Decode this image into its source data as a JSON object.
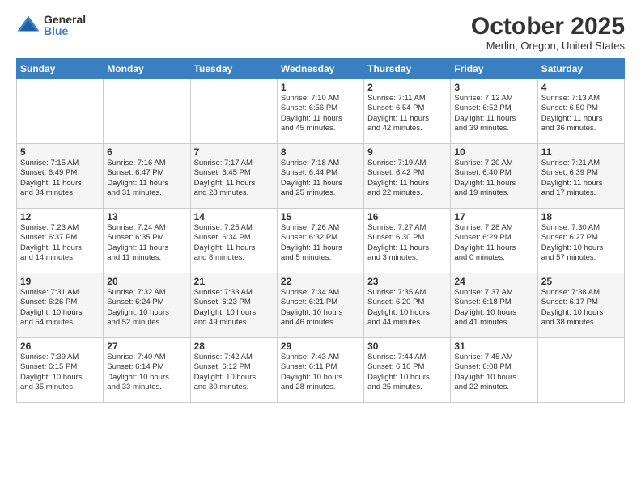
{
  "header": {
    "logo_general": "General",
    "logo_blue": "Blue",
    "month_title": "October 2025",
    "location": "Merlin, Oregon, United States"
  },
  "days_of_week": [
    "Sunday",
    "Monday",
    "Tuesday",
    "Wednesday",
    "Thursday",
    "Friday",
    "Saturday"
  ],
  "weeks": [
    [
      {
        "day": "",
        "info": ""
      },
      {
        "day": "",
        "info": ""
      },
      {
        "day": "",
        "info": ""
      },
      {
        "day": "1",
        "info": "Sunrise: 7:10 AM\nSunset: 6:56 PM\nDaylight: 11 hours\nand 45 minutes."
      },
      {
        "day": "2",
        "info": "Sunrise: 7:11 AM\nSunset: 6:54 PM\nDaylight: 11 hours\nand 42 minutes."
      },
      {
        "day": "3",
        "info": "Sunrise: 7:12 AM\nSunset: 6:52 PM\nDaylight: 11 hours\nand 39 minutes."
      },
      {
        "day": "4",
        "info": "Sunrise: 7:13 AM\nSunset: 6:50 PM\nDaylight: 11 hours\nand 36 minutes."
      }
    ],
    [
      {
        "day": "5",
        "info": "Sunrise: 7:15 AM\nSunset: 6:49 PM\nDaylight: 11 hours\nand 34 minutes."
      },
      {
        "day": "6",
        "info": "Sunrise: 7:16 AM\nSunset: 6:47 PM\nDaylight: 11 hours\nand 31 minutes."
      },
      {
        "day": "7",
        "info": "Sunrise: 7:17 AM\nSunset: 6:45 PM\nDaylight: 11 hours\nand 28 minutes."
      },
      {
        "day": "8",
        "info": "Sunrise: 7:18 AM\nSunset: 6:44 PM\nDaylight: 11 hours\nand 25 minutes."
      },
      {
        "day": "9",
        "info": "Sunrise: 7:19 AM\nSunset: 6:42 PM\nDaylight: 11 hours\nand 22 minutes."
      },
      {
        "day": "10",
        "info": "Sunrise: 7:20 AM\nSunset: 6:40 PM\nDaylight: 11 hours\nand 19 minutes."
      },
      {
        "day": "11",
        "info": "Sunrise: 7:21 AM\nSunset: 6:39 PM\nDaylight: 11 hours\nand 17 minutes."
      }
    ],
    [
      {
        "day": "12",
        "info": "Sunrise: 7:23 AM\nSunset: 6:37 PM\nDaylight: 11 hours\nand 14 minutes."
      },
      {
        "day": "13",
        "info": "Sunrise: 7:24 AM\nSunset: 6:35 PM\nDaylight: 11 hours\nand 11 minutes."
      },
      {
        "day": "14",
        "info": "Sunrise: 7:25 AM\nSunset: 6:34 PM\nDaylight: 11 hours\nand 8 minutes."
      },
      {
        "day": "15",
        "info": "Sunrise: 7:26 AM\nSunset: 6:32 PM\nDaylight: 11 hours\nand 5 minutes."
      },
      {
        "day": "16",
        "info": "Sunrise: 7:27 AM\nSunset: 6:30 PM\nDaylight: 11 hours\nand 3 minutes."
      },
      {
        "day": "17",
        "info": "Sunrise: 7:28 AM\nSunset: 6:29 PM\nDaylight: 11 hours\nand 0 minutes."
      },
      {
        "day": "18",
        "info": "Sunrise: 7:30 AM\nSunset: 6:27 PM\nDaylight: 10 hours\nand 57 minutes."
      }
    ],
    [
      {
        "day": "19",
        "info": "Sunrise: 7:31 AM\nSunset: 6:26 PM\nDaylight: 10 hours\nand 54 minutes."
      },
      {
        "day": "20",
        "info": "Sunrise: 7:32 AM\nSunset: 6:24 PM\nDaylight: 10 hours\nand 52 minutes."
      },
      {
        "day": "21",
        "info": "Sunrise: 7:33 AM\nSunset: 6:23 PM\nDaylight: 10 hours\nand 49 minutes."
      },
      {
        "day": "22",
        "info": "Sunrise: 7:34 AM\nSunset: 6:21 PM\nDaylight: 10 hours\nand 46 minutes."
      },
      {
        "day": "23",
        "info": "Sunrise: 7:35 AM\nSunset: 6:20 PM\nDaylight: 10 hours\nand 44 minutes."
      },
      {
        "day": "24",
        "info": "Sunrise: 7:37 AM\nSunset: 6:18 PM\nDaylight: 10 hours\nand 41 minutes."
      },
      {
        "day": "25",
        "info": "Sunrise: 7:38 AM\nSunset: 6:17 PM\nDaylight: 10 hours\nand 38 minutes."
      }
    ],
    [
      {
        "day": "26",
        "info": "Sunrise: 7:39 AM\nSunset: 6:15 PM\nDaylight: 10 hours\nand 35 minutes."
      },
      {
        "day": "27",
        "info": "Sunrise: 7:40 AM\nSunset: 6:14 PM\nDaylight: 10 hours\nand 33 minutes."
      },
      {
        "day": "28",
        "info": "Sunrise: 7:42 AM\nSunset: 6:12 PM\nDaylight: 10 hours\nand 30 minutes."
      },
      {
        "day": "29",
        "info": "Sunrise: 7:43 AM\nSunset: 6:11 PM\nDaylight: 10 hours\nand 28 minutes."
      },
      {
        "day": "30",
        "info": "Sunrise: 7:44 AM\nSunset: 6:10 PM\nDaylight: 10 hours\nand 25 minutes."
      },
      {
        "day": "31",
        "info": "Sunrise: 7:45 AM\nSunset: 6:08 PM\nDaylight: 10 hours\nand 22 minutes."
      },
      {
        "day": "",
        "info": ""
      }
    ]
  ]
}
